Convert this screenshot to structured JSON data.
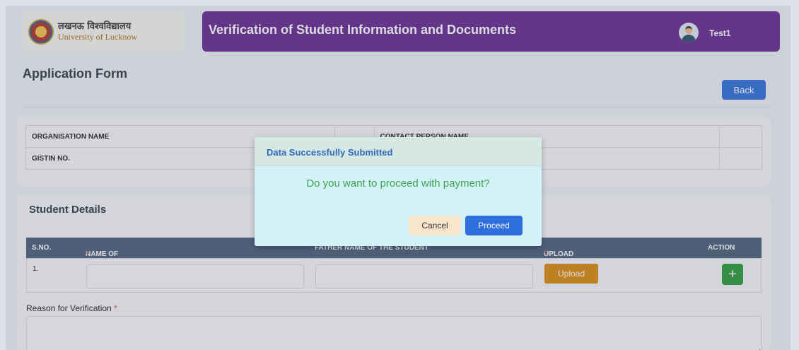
{
  "header": {
    "logo_hindi": "लखनऊ विश्वविद्यालय",
    "logo_english": "University of Lucknow",
    "title": "Verification of Student Information and Documents",
    "user_name": "Test1"
  },
  "page": {
    "title": "Application Form",
    "back_label": "Back"
  },
  "organisation": {
    "rows": [
      {
        "label": "ORGANISATION NAME",
        "label2": "CONTACT PERSON NAME"
      },
      {
        "label": "GISTIN NO.",
        "label2": ""
      }
    ]
  },
  "students": {
    "title": "Student Details",
    "columns": {
      "sno": "S.NO.",
      "name": "NAME OF STUDENT",
      "father": "FATHER NAME OF THE STUDENT",
      "upload": "UPLOAD DOCUMENTS",
      "action": "ACTION"
    },
    "required_mark": "*",
    "rows": [
      {
        "sno": "1.",
        "upload_label": "Upload",
        "add_label": "+"
      }
    ],
    "reason_label": "Reason for Verification"
  },
  "modal": {
    "title": "Data Successfully Submitted",
    "message": "Do you want to proceed with payment?",
    "cancel_label": "Cancel",
    "proceed_label": "Proceed"
  },
  "colors": {
    "header_purple": "#672a93",
    "primary_blue": "#2e6fdd",
    "upload_orange": "#d98a0e",
    "add_green": "#2c9a3c",
    "table_head": "#4c5f7c",
    "modal_bg": "#d3f1f8",
    "success_green": "#3fa24f"
  },
  "icons": {
    "logo": "university-seal-icon",
    "avatar": "user-avatar-icon",
    "add": "plus-icon"
  }
}
